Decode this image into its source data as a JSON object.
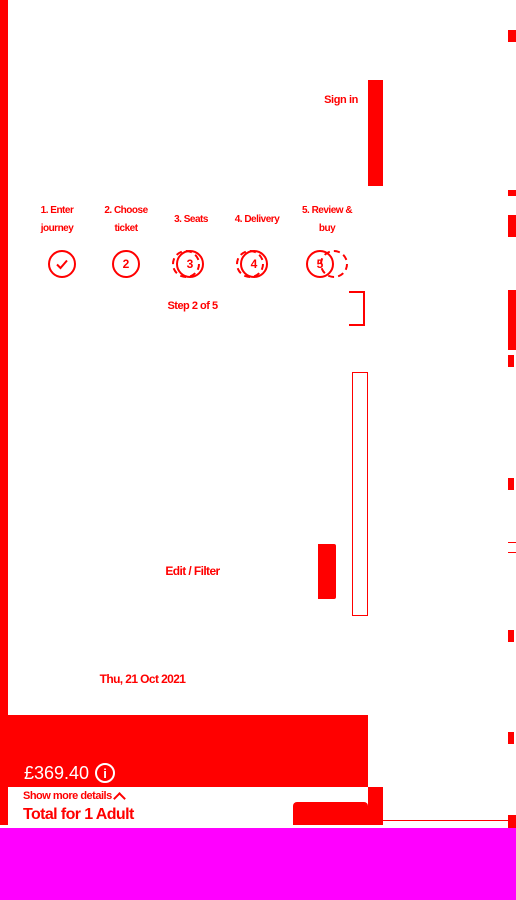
{
  "header": {
    "sign_in": "Sign in"
  },
  "steps": [
    {
      "label_line1": "1. Enter",
      "label_line2": "journey",
      "state": "done",
      "circle": "check-icon"
    },
    {
      "label_line1": "2. Choose",
      "label_line2": "ticket",
      "state": "current",
      "circle": "2"
    },
    {
      "label_line1": "3. Seats",
      "label_line2": "",
      "state": "upcoming",
      "circle": "3"
    },
    {
      "label_line1": "4. Delivery",
      "label_line2": "",
      "state": "upcoming",
      "circle": "4"
    },
    {
      "label_line1": "5. Review &",
      "label_line2": "buy",
      "state": "upcoming",
      "circle": "5"
    }
  ],
  "step_info": "Step 2 of 5",
  "edit_filter": "Edit / Filter",
  "date": "Thu, 21 Oct 2021",
  "footer": {
    "price": "£369.40",
    "info_icon": "info-icon",
    "show_more": "Show more details",
    "total_label": "Total for 1 Adult"
  },
  "colors": {
    "accent": "#ff0000",
    "band": "#ff00ff",
    "text_on_accent": "#ffffff"
  }
}
